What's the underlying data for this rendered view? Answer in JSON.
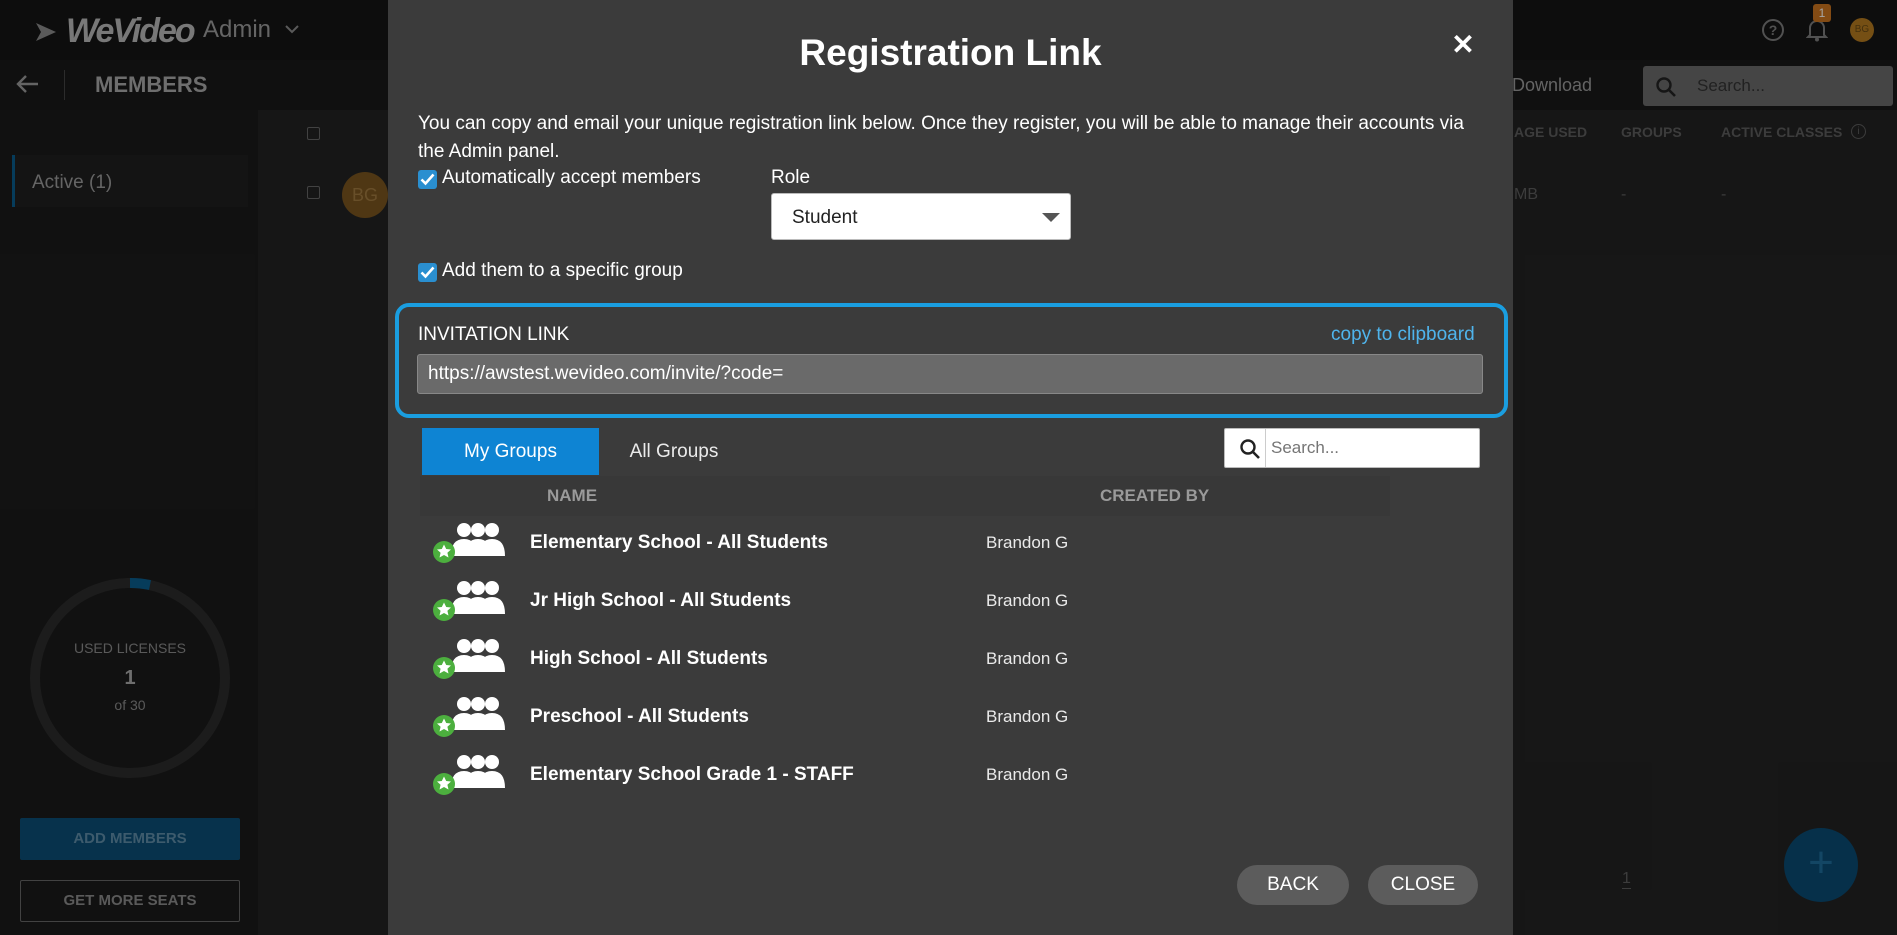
{
  "app": {
    "logo_text": "WeVideo",
    "section": "Admin",
    "notification_count": "1",
    "user_initials": "BG"
  },
  "members_page": {
    "title": "MEMBERS",
    "download_label": "Download",
    "search_placeholder": "Search...",
    "sidebar_active": "Active (1)",
    "license_label": "USED LICENSES",
    "license_used": "1",
    "license_total": "of 30",
    "add_members": "ADD MEMBERS",
    "get_more_seats": "GET MORE SEATS",
    "columns": [
      "AGE USED",
      "GROUPS",
      "ACTIVE CLASSES"
    ],
    "row": {
      "initials": "BG",
      "storage": "MB",
      "groups": "-",
      "classes": "-"
    },
    "page_number": "1"
  },
  "modal": {
    "title": "Registration Link",
    "intro": "You can copy and email your unique registration link below. Once they register, you will be able to manage their accounts via the Admin panel.",
    "auto_accept_label": "Automatically accept members",
    "auto_accept_checked": true,
    "role_label": "Role",
    "role_value": "Student",
    "add_group_label": "Add them to a specific group",
    "add_group_checked": true,
    "invitation_label": "INVITATION LINK",
    "copy_label": "copy to clipboard",
    "invitation_url": "https://awstest.wevideo.com/invite/?code=",
    "tabs": [
      {
        "label": "My Groups",
        "active": true
      },
      {
        "label": "All Groups",
        "active": false
      }
    ],
    "group_search_placeholder": "Search...",
    "group_columns": {
      "name": "NAME",
      "created_by": "CREATED BY"
    },
    "groups": [
      {
        "name": "Elementary School - All Students",
        "created_by": "Brandon G"
      },
      {
        "name": "Jr High School - All Students",
        "created_by": "Brandon G"
      },
      {
        "name": "High School - All Students",
        "created_by": "Brandon G"
      },
      {
        "name": "Preschool - All Students",
        "created_by": "Brandon G"
      },
      {
        "name": "Elementary School Grade 1 - STAFF",
        "created_by": "Brandon G"
      }
    ],
    "back_label": "BACK",
    "close_label": "CLOSE"
  },
  "colors": {
    "accent": "#0e84d3",
    "highlight_border": "#1a9ee0",
    "link": "#4fb4ec",
    "badge_green": "#4caf3e"
  }
}
